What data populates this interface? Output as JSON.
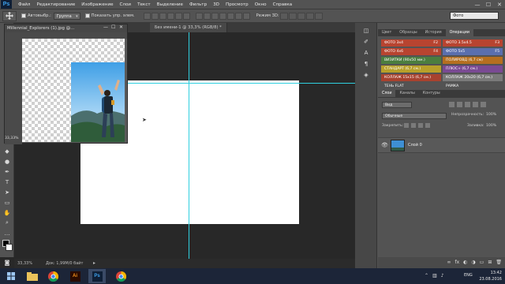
{
  "app": {
    "logo": "Ps"
  },
  "menu": {
    "items": [
      "Файл",
      "Редактирование",
      "Изображение",
      "Слои",
      "Текст",
      "Выделение",
      "Фильтр",
      "3D",
      "Просмотр",
      "Окно",
      "Справка"
    ]
  },
  "window_controls": {
    "minimize": "—",
    "maximize": "☐",
    "close": "✕"
  },
  "options": {
    "auto_select_label": "Автовыбр.:",
    "auto_select_value": "Группа",
    "show_controls_label": "Показать упр. элем.",
    "mode3d_label": "Режим 3D:",
    "workspace": "Фото"
  },
  "tabs": {
    "float_title": "Millennial_Explorers (1).jpg @...",
    "doc_tab": "Без имени-1 @ 33,3% (RGB/8) *"
  },
  "float_window": {
    "zoom": "33,33%"
  },
  "statusbar": {
    "zoom": "33,33%",
    "doc_info": "Док: 1,99M/0 байт"
  },
  "actions_panel": {
    "tabs": [
      "Цвет",
      "Образцы",
      "История",
      "Операции"
    ],
    "active_tab": "Операции",
    "buttons": [
      {
        "label": "ФОТО 3х4",
        "key": "F2",
        "color": "#b84430",
        "col": 0
      },
      {
        "label": "ФОТО 3.5х4.5",
        "key": "F3",
        "color": "#b84430",
        "col": 1
      },
      {
        "label": "ФОТО 4х6",
        "key": "F4",
        "color": "#b84430",
        "col": 0
      },
      {
        "label": "ФОТО 5х5",
        "key": "F5",
        "color": "#5a6fae",
        "col": 1
      },
      {
        "label": "ВИЗИТКИ (90х50 мм.)",
        "key": "",
        "color": "#4b7d3f",
        "col": 0
      },
      {
        "label": "ПОЛИРОВД (6,7 см)",
        "key": "",
        "color": "#b56f1f",
        "col": 1
      },
      {
        "label": "СТАНДАРТ (6,7 см.)",
        "key": "",
        "color": "#b8a02a",
        "col": 0
      },
      {
        "label": "ПЛЮС+ (6,7 см.)",
        "key": "",
        "color": "#7a4a93",
        "col": 1
      },
      {
        "label": "КОЛЛАЖ 15х15 (6,7 см.)",
        "key": "",
        "color": "#a8422f",
        "col": 0
      },
      {
        "label": "КОЛЛАЖ 20х20 (6,7 см.)",
        "key": "",
        "color": "#7a7a7a",
        "col": 1
      },
      {
        "label": "ТЕНЬ FLAT",
        "key": "",
        "color": "#535353",
        "col": 0
      },
      {
        "label": "РАМКА",
        "key": "",
        "color": "#535353",
        "col": 1
      }
    ]
  },
  "layers_panel": {
    "tabs": [
      "Слои",
      "Каналы",
      "Контуры"
    ],
    "active_tab": "Слои",
    "filter_kind": "Вид",
    "blend_mode": "Обычные",
    "opacity_label": "Непрозрачность:",
    "opacity_value": "100%",
    "lock_label": "Закрепить:",
    "fill_label": "Заливка:",
    "fill_value": "100%",
    "layer_name": "Слой 0"
  },
  "taskbar": {
    "lang": "ENG",
    "time": "13:42",
    "date": "23.08.2016",
    "apps": [
      "folder-icon",
      "chrome-icon",
      "illustrator-icon",
      "photoshop-icon",
      "chrome-icon"
    ]
  },
  "colors": {
    "guide": "#2fd0e0",
    "canvas": "#ffffff",
    "workspace_bg": "#282828"
  }
}
